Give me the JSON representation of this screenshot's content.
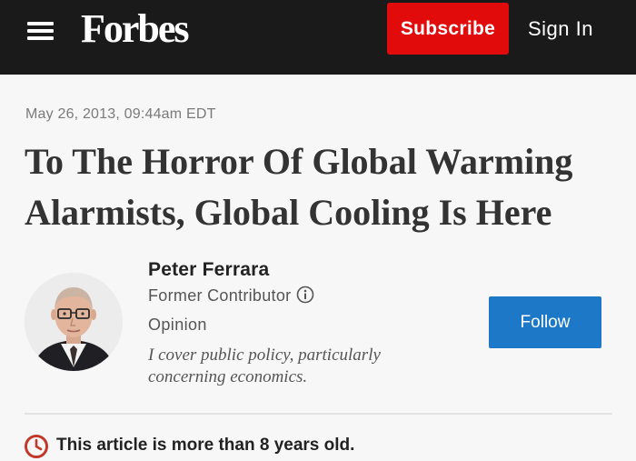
{
  "header": {
    "logo_text": "Forbes",
    "subscribe_label": "Subscribe",
    "signin_label": "Sign In",
    "menu_icon": "hamburger-menu-icon",
    "background_color": "#1a1a1a",
    "subscribe_color": "#e20b0b"
  },
  "article": {
    "date": "May 26, 2013, 09:44am EDT",
    "title": "To The Horror Of Global Warming Alarmists, Global Cooling Is Here"
  },
  "author": {
    "name": "Peter Ferrara",
    "role": "Former Contributor",
    "section": "Opinion",
    "bio": "I cover public policy, particularly concerning economics.",
    "follow_label": "Follow",
    "follow_color": "#1e78c8",
    "info_icon": "info-circle-icon"
  },
  "notice": {
    "text": "This article is more than 8 years old.",
    "icon": "clock-icon",
    "icon_color": "#c0392b"
  }
}
